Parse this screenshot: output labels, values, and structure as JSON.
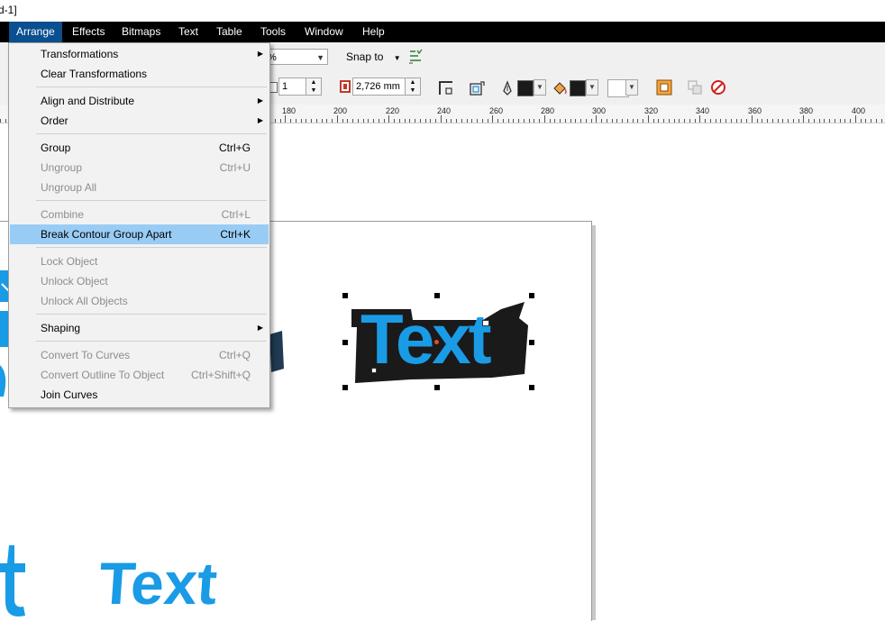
{
  "window": {
    "title_fragment": "d-1]"
  },
  "menubar": [
    {
      "label": "Arrange",
      "active": true
    },
    {
      "label": "Effects"
    },
    {
      "label": "Bitmaps"
    },
    {
      "label": "Text"
    },
    {
      "label": "Table"
    },
    {
      "label": "Tools"
    },
    {
      "label": "Window"
    },
    {
      "label": "Help"
    }
  ],
  "toolbar1": {
    "zoom_value": "%",
    "snap_to_label": "Snap to"
  },
  "toolbar2": {
    "count_value": "1",
    "outline_width_value": "2,726 mm"
  },
  "ruler": {
    "labels": [
      "180",
      "200",
      "220",
      "240",
      "260",
      "280",
      "300",
      "320",
      "340",
      "360",
      "380",
      "400"
    ]
  },
  "arrange_menu": {
    "items": [
      {
        "label": "Transformations",
        "shortcut": "",
        "submenu": true,
        "disabled": false
      },
      {
        "label": "Clear Transformations",
        "shortcut": "",
        "submenu": false,
        "disabled": false
      },
      {
        "label": "Align and Distribute",
        "shortcut": "",
        "submenu": true,
        "disabled": false
      },
      {
        "label": "Order",
        "shortcut": "",
        "submenu": true,
        "disabled": false
      },
      {
        "label": "Group",
        "shortcut": "Ctrl+G",
        "submenu": false,
        "disabled": false
      },
      {
        "label": "Ungroup",
        "shortcut": "Ctrl+U",
        "submenu": false,
        "disabled": true
      },
      {
        "label": "Ungroup All",
        "shortcut": "",
        "submenu": false,
        "disabled": true
      },
      {
        "label": "Combine",
        "shortcut": "Ctrl+L",
        "submenu": false,
        "disabled": true
      },
      {
        "label": "Break Contour Group Apart",
        "shortcut": "Ctrl+K",
        "submenu": false,
        "disabled": false,
        "highlighted": true
      },
      {
        "label": "Lock Object",
        "shortcut": "",
        "submenu": false,
        "disabled": true
      },
      {
        "label": "Unlock Object",
        "shortcut": "",
        "submenu": false,
        "disabled": true
      },
      {
        "label": "Unlock All Objects",
        "shortcut": "",
        "submenu": false,
        "disabled": true
      },
      {
        "label": "Shaping",
        "shortcut": "",
        "submenu": true,
        "disabled": false
      },
      {
        "label": "Convert To Curves",
        "shortcut": "Ctrl+Q",
        "submenu": false,
        "disabled": true
      },
      {
        "label": "Convert Outline To Object",
        "shortcut": "Ctrl+Shift+Q",
        "submenu": false,
        "disabled": true
      },
      {
        "label": "Join Curves",
        "shortcut": "",
        "submenu": false,
        "disabled": false
      }
    ]
  },
  "canvas": {
    "selected_text": "Text",
    "bottom_text": "Text",
    "text_fill_color": "#1a9be6",
    "contour_color": "#1a1a1a",
    "selection_highlight": "#99ccf5"
  }
}
